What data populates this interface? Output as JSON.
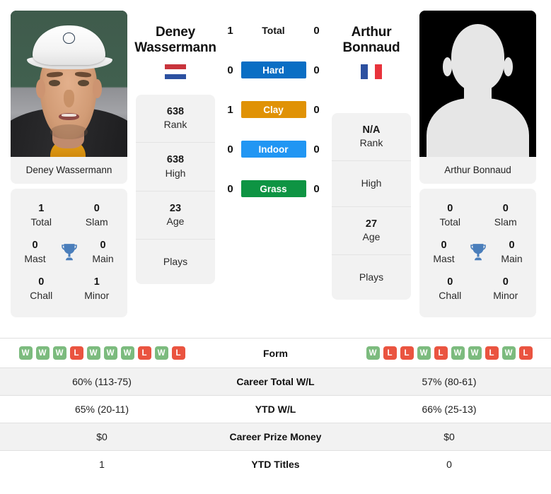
{
  "players": {
    "left": {
      "name_line1": "Deney",
      "name_line2": "Wassermann",
      "full_name": "Deney Wassermann",
      "country": "Netherlands",
      "flag": "nl-flag-icon",
      "photo": "player-photo",
      "rank": "638",
      "rank_label": "Rank",
      "high": "638",
      "high_label": "High",
      "age": "23",
      "age_label": "Age",
      "plays_label": "Plays",
      "plays_value": "",
      "titles": {
        "total": "1",
        "total_label": "Total",
        "slam": "0",
        "slam_label": "Slam",
        "mast": "0",
        "mast_label": "Mast",
        "main": "0",
        "main_label": "Main",
        "chall": "0",
        "chall_label": "Chall",
        "minor": "1",
        "minor_label": "Minor"
      },
      "form": [
        "W",
        "W",
        "W",
        "L",
        "W",
        "W",
        "W",
        "L",
        "W",
        "L"
      ],
      "career_wl": "60% (113-75)",
      "ytd_wl": "65% (20-11)",
      "prize_money": "$0",
      "ytd_titles": "1"
    },
    "right": {
      "name_line1": "Arthur",
      "name_line2": "Bonnaud",
      "full_name": "Arthur Bonnaud",
      "country": "France",
      "flag": "fr-flag-icon",
      "photo": "player-silhouette-placeholder",
      "rank": "N/A",
      "rank_label": "Rank",
      "high": "",
      "high_label": "High",
      "age": "27",
      "age_label": "Age",
      "plays_label": "Plays",
      "plays_value": "",
      "titles": {
        "total": "0",
        "total_label": "Total",
        "slam": "0",
        "slam_label": "Slam",
        "mast": "0",
        "mast_label": "Mast",
        "main": "0",
        "main_label": "Main",
        "chall": "0",
        "chall_label": "Chall",
        "minor": "0",
        "minor_label": "Minor"
      },
      "form": [
        "W",
        "L",
        "L",
        "W",
        "L",
        "W",
        "W",
        "L",
        "W",
        "L"
      ],
      "career_wl": "57% (80-61)",
      "ytd_wl": "66% (25-13)",
      "prize_money": "$0",
      "ytd_titles": "0"
    }
  },
  "head_to_head": [
    {
      "label": "Total",
      "left": "1",
      "right": "0",
      "color": "none",
      "style": "plain"
    },
    {
      "label": "Hard",
      "left": "0",
      "right": "0",
      "color": "#0a6ec4",
      "style": "pill"
    },
    {
      "label": "Clay",
      "left": "1",
      "right": "0",
      "color": "#e09205",
      "style": "pill"
    },
    {
      "label": "Indoor",
      "left": "0",
      "right": "0",
      "color": "#2196f3",
      "style": "pill"
    },
    {
      "label": "Grass",
      "left": "0",
      "right": "0",
      "color": "#0e9443",
      "style": "pill"
    }
  ],
  "table": {
    "rows": [
      {
        "label": "Form",
        "type": "form",
        "shaded": false
      },
      {
        "label": "Career Total W/L",
        "type": "text",
        "shaded": true,
        "left": "60% (113-75)",
        "right": "57% (80-61)"
      },
      {
        "label": "YTD W/L",
        "type": "text",
        "shaded": false,
        "left": "65% (20-11)",
        "right": "66% (25-13)"
      },
      {
        "label": "Career Prize Money",
        "type": "text",
        "shaded": true,
        "left": "$0",
        "right": "$0"
      },
      {
        "label": "YTD Titles",
        "type": "text",
        "shaded": false,
        "left": "1",
        "right": "0"
      }
    ]
  },
  "colors": {
    "hard": "#0a6ec4",
    "clay": "#e09205",
    "indoor": "#2196f3",
    "grass": "#0e9443",
    "win_badge": "#7cbb7e",
    "loss_badge": "#ea5440",
    "trophy": "#4a7ebb",
    "card_bg": "#f2f2f2"
  }
}
